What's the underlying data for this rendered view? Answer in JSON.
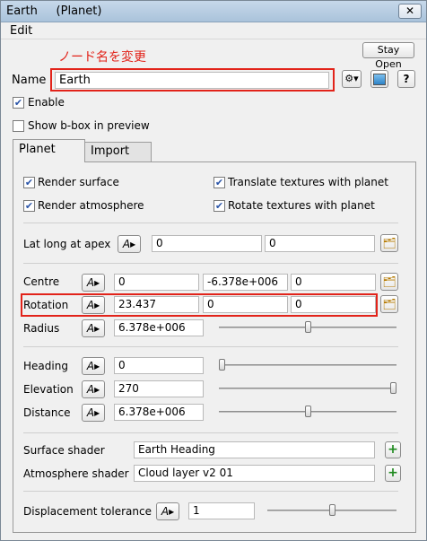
{
  "window": {
    "title": "Earth",
    "subtitle": "(Planet)",
    "close_glyph": "✕"
  },
  "menu": {
    "edit": "Edit"
  },
  "annotation": "ノード名を変更",
  "stay_open": "Stay Open",
  "name_row": {
    "label": "Name",
    "value": "Earth",
    "help": "?"
  },
  "enable": {
    "label": "Enable",
    "checked": true
  },
  "show_bbox": {
    "label": "Show b-box in preview",
    "checked": false
  },
  "tabs": [
    {
      "label": "Planet"
    },
    {
      "label": "Import"
    }
  ],
  "checks": {
    "render_surface": "Render surface",
    "render_atmosphere": "Render atmosphere",
    "translate_textures": "Translate textures with planet",
    "rotate_textures": "Rotate textures with planet"
  },
  "lat_long": {
    "label": "Lat long at apex",
    "v1": "0",
    "v2": "0"
  },
  "centre": {
    "label": "Centre",
    "x": "0",
    "y": "-6.378e+006",
    "z": "0"
  },
  "rotation": {
    "label": "Rotation",
    "x": "23.437",
    "y": "0",
    "z": "0"
  },
  "radius": {
    "label": "Radius",
    "value": "6.378e+006",
    "slider_fraction": 0.5
  },
  "heading": {
    "label": "Heading",
    "value": "0",
    "slider_fraction": 0.0
  },
  "elevation": {
    "label": "Elevation",
    "value": "270",
    "slider_fraction": 1.0
  },
  "distance": {
    "label": "Distance",
    "value": "6.378e+006",
    "slider_fraction": 0.5
  },
  "surface_shader": {
    "label": "Surface shader",
    "value": "Earth Heading"
  },
  "atmosphere_shader": {
    "label": "Atmosphere shader",
    "value": "Cloud layer v2 01"
  },
  "displacement": {
    "label": "Displacement tolerance",
    "value": "1",
    "slider_fraction": 0.5
  },
  "icons": {
    "anim": "A▸",
    "folder": "🗂",
    "plus": "+",
    "gear": "⚙▾"
  },
  "colors": {
    "annotation_red": "#e2231a",
    "check_blue": "#2a54a8"
  }
}
